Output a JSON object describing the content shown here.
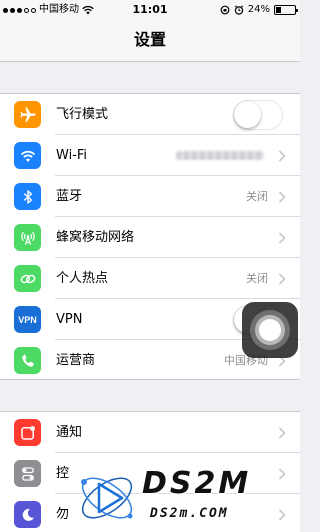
{
  "status_bar": {
    "carrier": "中国移动",
    "time": "11:01",
    "battery_percent_text": "24%",
    "battery_level": 0.24
  },
  "nav": {
    "title": "设置"
  },
  "groups": [
    {
      "cells": [
        {
          "label": "飞行模式",
          "icon": "airplane-icon",
          "color": "#ff9500",
          "accessory": "toggle",
          "toggle_on": false
        },
        {
          "label": "Wi-Fi",
          "icon": "wifi-icon",
          "color": "#1a82fb",
          "accessory": "chevron",
          "value_obscured": true
        },
        {
          "label": "蓝牙",
          "icon": "bluetooth-icon",
          "color": "#1a82fb",
          "accessory": "chevron",
          "value": "关闭"
        },
        {
          "label": "蜂窝移动网络",
          "icon": "cellular-icon",
          "color": "#4cd964",
          "accessory": "chevron",
          "value": ""
        },
        {
          "label": "个人热点",
          "icon": "hotspot-icon",
          "color": "#4cd964",
          "accessory": "chevron",
          "value": "关闭"
        },
        {
          "label": "VPN",
          "icon": "vpn-icon",
          "icon_text": "VPN",
          "color": "#1a6fd6",
          "accessory": "toggle",
          "toggle_on": false
        },
        {
          "label": "运营商",
          "icon": "phone-icon",
          "color": "#4cd964",
          "accessory": "chevron",
          "value": "中国移动"
        }
      ]
    },
    {
      "cells": [
        {
          "label": "通知",
          "icon": "notifications-icon",
          "color": "#ff3b30",
          "accessory": "chevron",
          "value": ""
        },
        {
          "label": "控",
          "icon": "control-center-icon",
          "color": "#8e8e93",
          "accessory": "chevron",
          "value": ""
        },
        {
          "label": "勿",
          "icon": "moon-icon",
          "color": "#5856d6",
          "accessory": "chevron",
          "value": ""
        }
      ]
    }
  ],
  "watermark": {
    "big": "DS2M",
    "small": "DS2m.COM"
  }
}
